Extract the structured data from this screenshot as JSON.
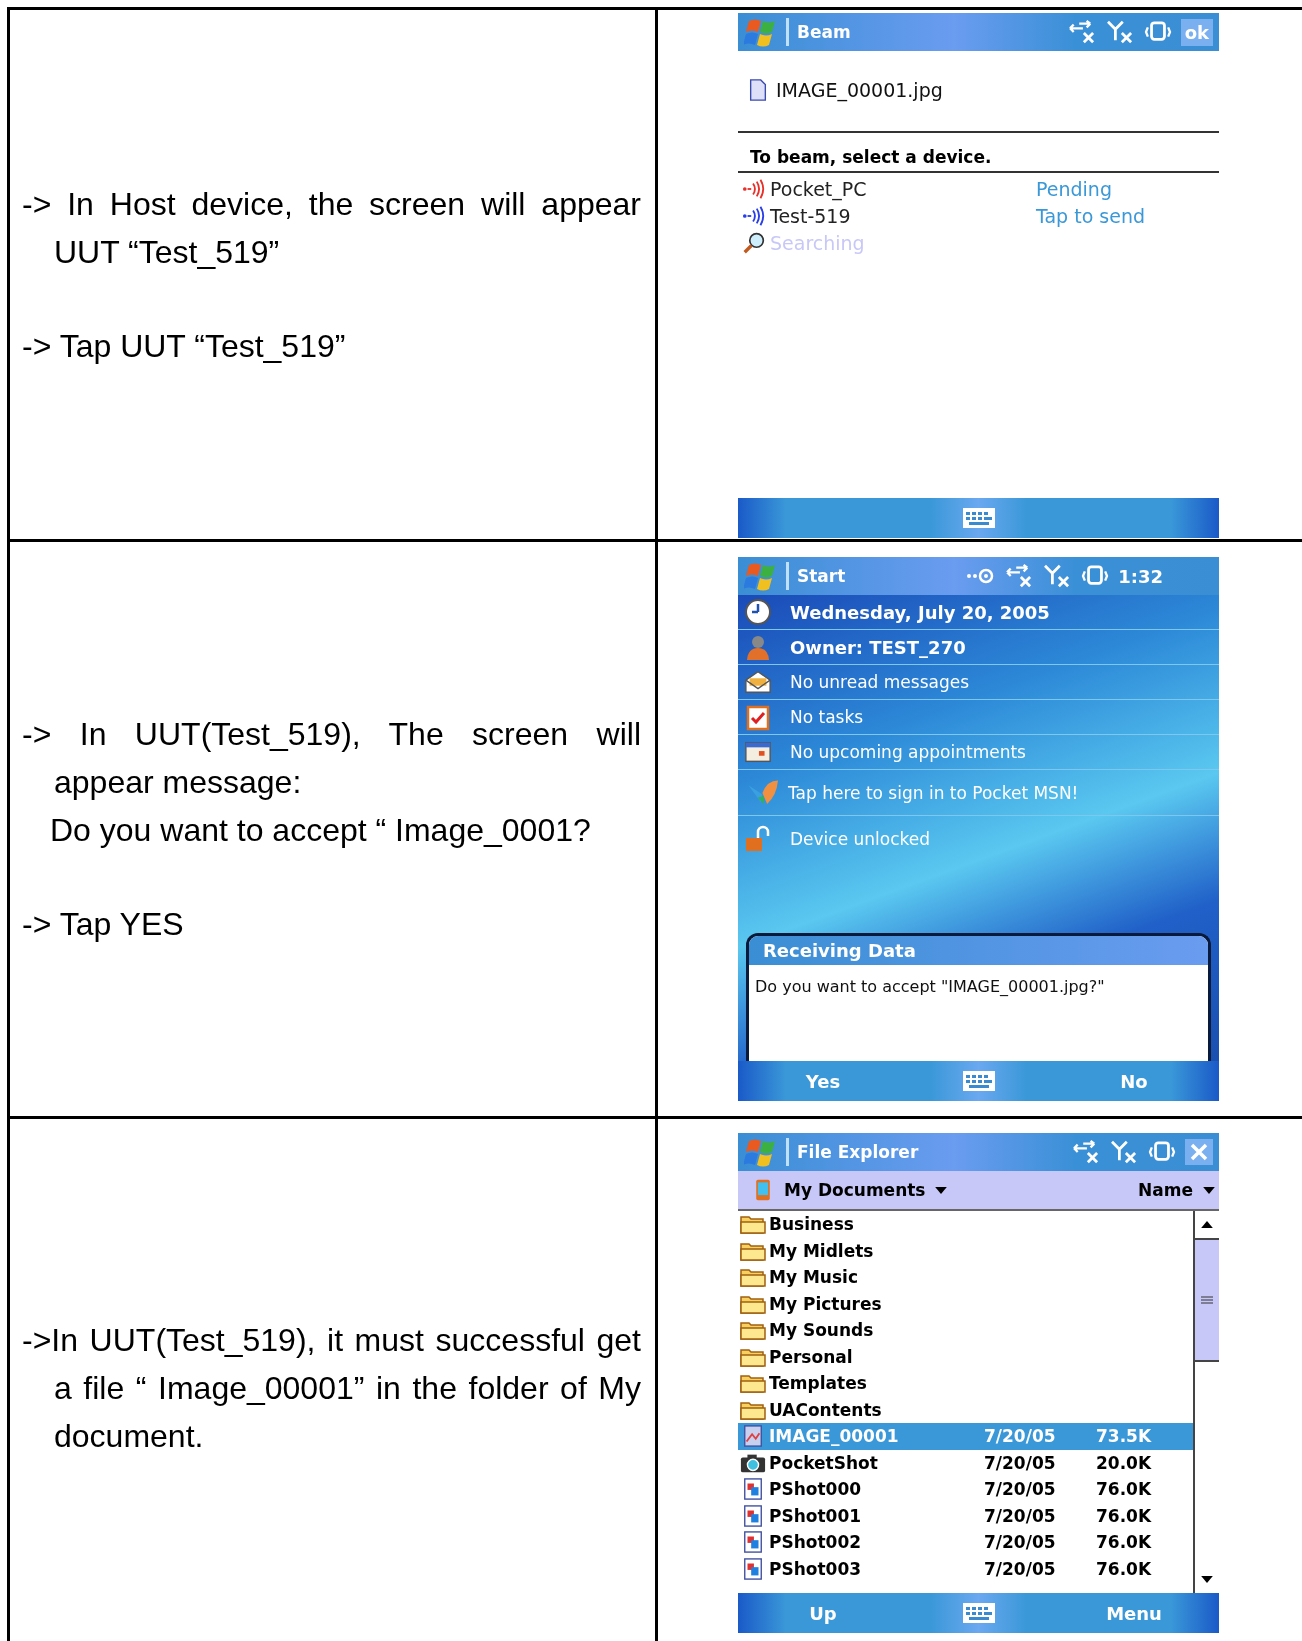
{
  "steps": [
    {
      "instructions": [
        [
          {
            "kind": "step",
            "text": "-> In Host device, the screen will appear UUT “Test_519”"
          }
        ],
        [
          {
            "kind": "step",
            "text": "-> Tap UUT “Test_519”"
          }
        ]
      ],
      "screen": {
        "kind": "beam",
        "title": "Beam",
        "ok": "ok",
        "file": "IMAGE_00001.jpg",
        "prompt": "To beam, select a device.",
        "devices": [
          {
            "kind": "device",
            "name": "Pocket_PC",
            "status": "Pending",
            "color": "#e8302a"
          },
          {
            "kind": "device",
            "name": "Test-519",
            "status": "Tap to send",
            "color": "#2a3ee8"
          },
          {
            "kind": "searching",
            "name": "Searching"
          }
        ]
      }
    },
    {
      "instructions": [
        [
          {
            "kind": "step",
            "text": "-> In UUT(Test_519), The screen will appear message:"
          },
          {
            "kind": "continuation",
            "text": "Do you want to accept “ Image_0001?"
          }
        ],
        [
          {
            "kind": "step",
            "text": "-> Tap YES"
          }
        ]
      ],
      "screen": {
        "kind": "today",
        "title": "Start",
        "time": "1:32",
        "items": [
          {
            "kind": "clock",
            "text": "Wednesday, July 20, 2005",
            "bold": true
          },
          {
            "kind": "owner",
            "text": "Owner: TEST_270",
            "bold": true
          },
          {
            "kind": "messages",
            "text": "No unread messages",
            "bold": false
          },
          {
            "kind": "tasks",
            "text": "No tasks",
            "bold": false
          },
          {
            "kind": "calendar",
            "text": "No upcoming appointments",
            "bold": false
          },
          {
            "kind": "msn",
            "text": "Tap here to sign in to Pocket MSN!",
            "bold": false
          },
          {
            "kind": "lock",
            "text": "Device unlocked",
            "bold": false
          }
        ],
        "dialog": {
          "title": "Receiving Data",
          "message": "Do you want to accept \"IMAGE_00001.jpg?\""
        },
        "softkeys": [
          "Yes",
          "No"
        ]
      }
    },
    {
      "instructions": [
        [
          {
            "kind": "step",
            "text": "->In UUT(Test_519), it must successful get a file “ Image_00001” in the folder of My document."
          }
        ]
      ],
      "screen": {
        "kind": "explorer",
        "title": "File Explorer",
        "folder": "My Documents",
        "sort": "Name",
        "files": [
          {
            "kind": "folder",
            "name": "Business",
            "selected": false
          },
          {
            "kind": "folder",
            "name": "My Midlets",
            "selected": false
          },
          {
            "kind": "folder",
            "name": "My Music",
            "selected": false
          },
          {
            "kind": "folder",
            "name": "My Pictures",
            "selected": false
          },
          {
            "kind": "folder",
            "name": "My Sounds",
            "selected": false
          },
          {
            "kind": "folder",
            "name": "Personal",
            "selected": false
          },
          {
            "kind": "folder",
            "name": "Templates",
            "selected": false
          },
          {
            "kind": "folder",
            "name": "UAContents",
            "selected": false
          },
          {
            "kind": "image",
            "name": "IMAGE_00001",
            "date": "7/20/05",
            "size": "73.5K",
            "selected": true
          },
          {
            "kind": "camera",
            "name": "PocketShot",
            "date": "7/20/05",
            "size": "20.0K",
            "selected": false
          },
          {
            "kind": "picture",
            "name": "PShot000",
            "date": "7/20/05",
            "size": "76.0K",
            "selected": false
          },
          {
            "kind": "picture",
            "name": "PShot001",
            "date": "7/20/05",
            "size": "76.0K",
            "selected": false
          },
          {
            "kind": "picture",
            "name": "PShot002",
            "date": "7/20/05",
            "size": "76.0K",
            "selected": false
          },
          {
            "kind": "picture",
            "name": "PShot003",
            "date": "7/20/05",
            "size": "76.0K",
            "selected": false
          }
        ],
        "softkeys": [
          "Up",
          "Menu"
        ]
      }
    }
  ]
}
